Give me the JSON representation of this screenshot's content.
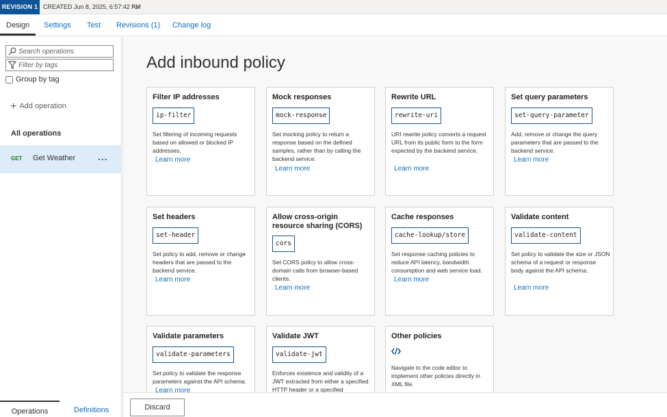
{
  "revision": {
    "badge": "REVISION 1",
    "created": "CREATED Jun 8, 2025, 6:57:42 PM"
  },
  "tabs": [
    {
      "label": "Design"
    },
    {
      "label": "Settings"
    },
    {
      "label": "Test"
    },
    {
      "label": "Revisions (1)"
    },
    {
      "label": "Change log"
    }
  ],
  "sidebar": {
    "search_placeholder": "Search operations",
    "filter_placeholder": "Filter by tags",
    "group_by_label": "Group by tag",
    "add_operation": "Add operation",
    "all_operations": "All operations",
    "operations": [
      {
        "verb": "GET",
        "name": "Get Weather",
        "more": "..."
      }
    ],
    "bottom_tabs": [
      {
        "label": "Operations"
      },
      {
        "label": "Definitions"
      }
    ]
  },
  "main": {
    "title": "Add inbound policy",
    "learn_more": "Learn more",
    "cards": [
      {
        "title": "Filter IP addresses",
        "code": "ip-filter",
        "desc": "Set filtering of incoming requests based on allowed or blocked IP addresses."
      },
      {
        "title": "Mock responses",
        "code": "mock-response",
        "desc": "Set mocking policy to return a response based on the defined samples, rather than by calling the backend service."
      },
      {
        "title": "Rewrite URL",
        "code": "rewrite-uri",
        "desc": "URI rewrite policy converts a request URL from its public form to the form expected by the backend service."
      },
      {
        "title": "Set query parameters",
        "code": "set-query-parameter",
        "desc": "Add, remove or change the query parameters that are passed to the backend service."
      },
      {
        "title": "Set headers",
        "code": "set-header",
        "desc": "Set policy to add, remove or change headers that are passed to the backend service."
      },
      {
        "title": "Allow cross-origin resource sharing (CORS)",
        "code": "cors",
        "desc": "Set CORS policy to allow cross-domain calls from browser-based clients."
      },
      {
        "title": "Cache responses",
        "code": "cache-lookup/store",
        "desc": "Set response caching policies to reduce API latency, bandwidth consumption and web service load."
      },
      {
        "title": "Validate content",
        "code": "validate-content",
        "desc": "Set policy to validate the size or JSON schema of a request or response body against the API schema."
      },
      {
        "title": "Validate parameters",
        "code": "validate-parameters",
        "desc": "Set policy to validate the response parameters against the API schema."
      },
      {
        "title": "Validate JWT",
        "code": "validate-jwt",
        "desc": "Enforces existence and validity of a JWT extracted from either a specified HTTP header or a specified"
      },
      {
        "title": "Other policies",
        "icon": "code-icon",
        "desc": "Navigate to the code editor to implement other policies directly in XML file."
      }
    ]
  },
  "footer": {
    "discard_label": "Discard"
  }
}
